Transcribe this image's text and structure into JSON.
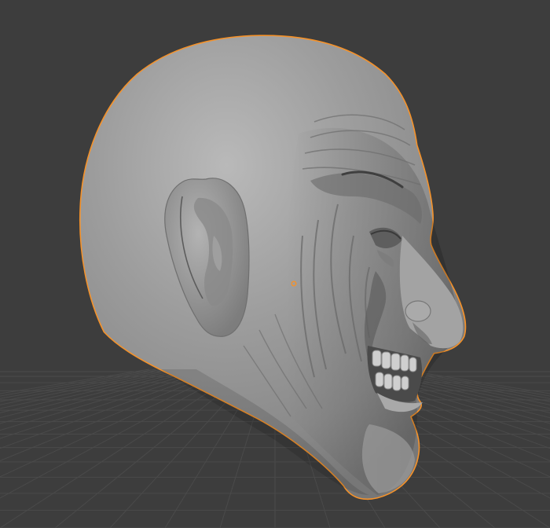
{
  "viewport": {
    "background_color": "#3d3d3d",
    "grid_color": "#4a4a4a",
    "selection_outline_color": "#f5922a",
    "mesh_color": "#8e8e8e",
    "origin_marker_color": "#f5922a"
  },
  "object": {
    "type": "sculpted-head-mesh",
    "selected": "true"
  }
}
